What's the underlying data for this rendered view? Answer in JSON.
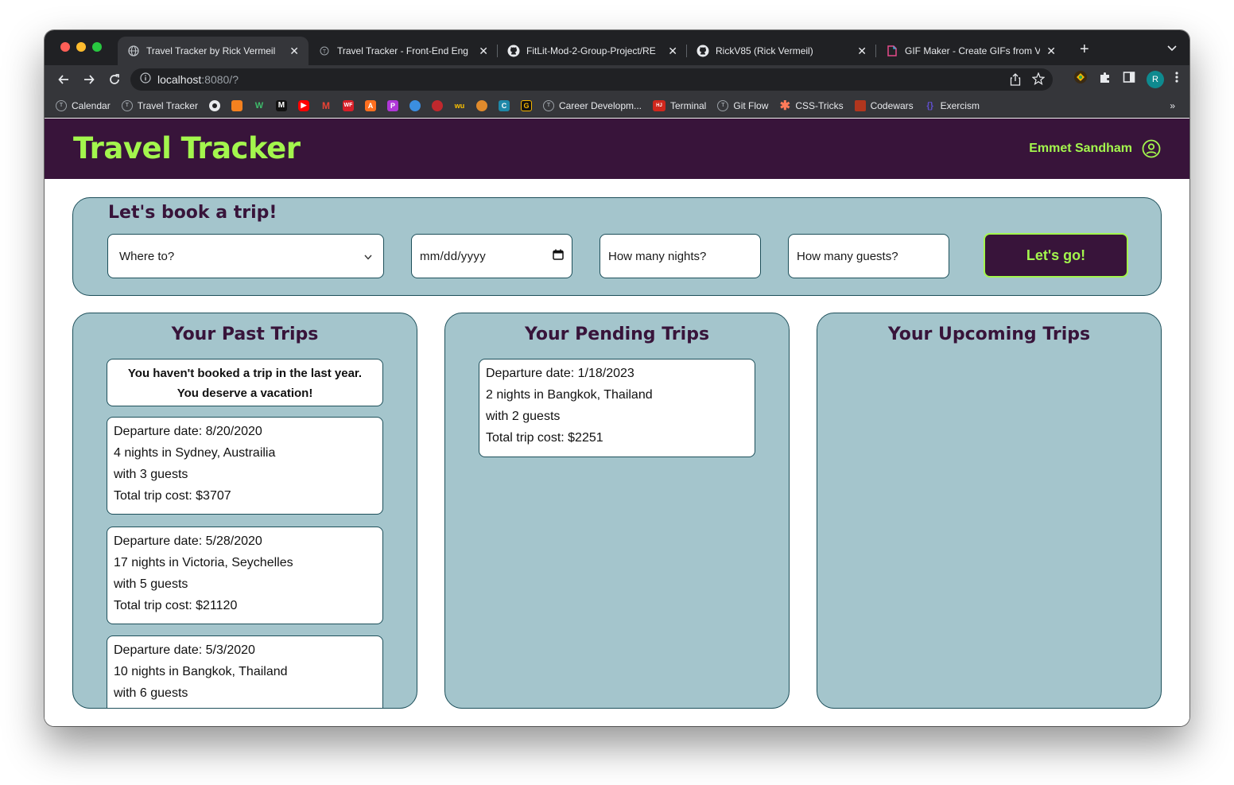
{
  "browser": {
    "tabs": [
      {
        "title": "Travel Tracker by Rick Vermeil",
        "active": true
      },
      {
        "title": "Travel Tracker - Front-End Eng"
      },
      {
        "title": "FitLit-Mod-2-Group-Project/RE"
      },
      {
        "title": "RickV85 (Rick Vermeil)"
      },
      {
        "title": "GIF Maker - Create GIFs from V"
      }
    ],
    "url_host": "localhost",
    "url_rest": ":8080/?",
    "profile_initial": "R",
    "bookmarks": [
      {
        "label": "Calendar"
      },
      {
        "label": "Travel Tracker"
      },
      {
        "label": "Career Developm..."
      },
      {
        "label": "Terminal"
      },
      {
        "label": "Git Flow"
      },
      {
        "label": "CSS-Tricks"
      },
      {
        "label": "Codewars"
      },
      {
        "label": "Exercism"
      }
    ],
    "bookmarks_more": "»"
  },
  "header": {
    "title": "Travel Tracker",
    "user_name": "Emmet Sandham"
  },
  "booking": {
    "title": "Let's book a trip!",
    "destination_value": "Where to?",
    "date_placeholder": "mm/dd/yyyy",
    "nights_placeholder": "How many nights?",
    "guests_placeholder": "How many guests?",
    "submit_label": "Let's go!"
  },
  "past": {
    "title": "Your Past Trips",
    "notice_line1": "You haven't booked a trip in the last year.",
    "notice_line2": "You deserve a vacation!",
    "trips": [
      {
        "departure": "Departure date: 8/20/2020",
        "nights": "4 nights in Sydney, Austrailia",
        "guests": "with 3 guests",
        "cost": "Total trip cost: $3707"
      },
      {
        "departure": "Departure date: 5/28/2020",
        "nights": "17 nights in Victoria, Seychelles",
        "guests": "with 5 guests",
        "cost": "Total trip cost: $21120"
      },
      {
        "departure": "Departure date: 5/3/2020",
        "nights": "10 nights in Bangkok, Thailand",
        "guests": "with 6 guests",
        "cost": ""
      }
    ]
  },
  "pending": {
    "title": "Your Pending Trips",
    "trips": [
      {
        "departure": "Departure date: 1/18/2023",
        "nights": "2 nights in Bangkok, Thailand",
        "guests": "with 2 guests",
        "cost": "Total trip cost: $2251"
      }
    ]
  },
  "upcoming": {
    "title": "Your Upcoming Trips"
  },
  "colors": {
    "header_bg": "#38143a",
    "accent_green": "#a3f64d",
    "panel_bg": "#a4c5cc",
    "panel_border": "#1d4f5a"
  }
}
